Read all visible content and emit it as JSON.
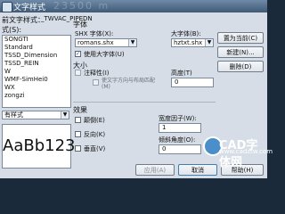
{
  "window": {
    "title": "文字样式",
    "background_text": "23500 m"
  },
  "current_style": {
    "label": "前文字样式：",
    "value": "_TWVAC_PIPEDN"
  },
  "styles": {
    "label": "式(S):",
    "items": [
      "SONGTI",
      "Standard",
      "TSSD_Dimension",
      "TSSD_REIN",
      "W",
      "WMF-SimHei0",
      "WX",
      "zongzi"
    ]
  },
  "filter": {
    "value": "有样式"
  },
  "preview": {
    "text": "AaBb123"
  },
  "font": {
    "section_label": "字体",
    "shx_label": "SHX 字体(X):",
    "shx_value": "romans.shx",
    "bigfont_label": "大字体(B):",
    "bigfont_value": "hztxt.shx",
    "use_bigfont_label": "使用大字体(U)",
    "use_bigfont_checked": true
  },
  "size": {
    "section_label": "大小",
    "annotative_label": "注释性(I)",
    "match_orientation_label": "使文字方向与布局匹配(M)",
    "height_label": "高度(T)",
    "height_value": "0"
  },
  "effects": {
    "section_label": "效果",
    "upside_down_label": "颠倒(E)",
    "backwards_label": "反向(K)",
    "vertical_label": "垂直(V)",
    "width_factor_label": "宽度因子(W):",
    "width_factor_value": "1",
    "oblique_label": "倾斜角度(O):",
    "oblique_value": "0"
  },
  "buttons": {
    "set_current": "置为当前(C)",
    "new": "新建(N)...",
    "delete": "删除(D)",
    "apply": "应用(A)",
    "cancel": "取消",
    "help": "帮助(H)"
  },
  "watermark": {
    "brand": "CAD字体网",
    "url": "www.cadztw.com"
  },
  "colors": {
    "dialog_bg": "#d6dde6",
    "titlebar": "#4f6b88",
    "check_blue": "#1a4f9a"
  }
}
